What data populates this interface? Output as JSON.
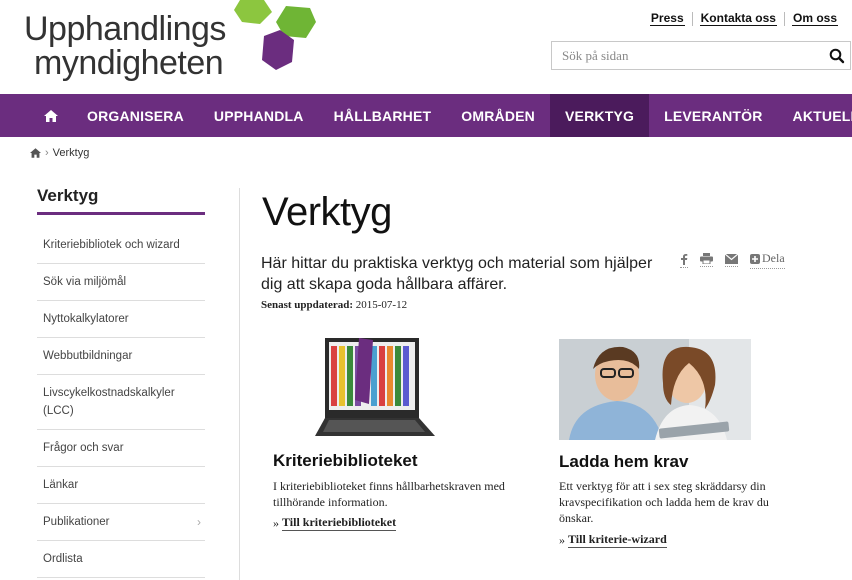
{
  "logo": {
    "line1": "Upphandlings",
    "line2": "myndigheten"
  },
  "toplinks": [
    "Press",
    "Kontakta oss",
    "Om oss"
  ],
  "search": {
    "placeholder": "Sök på sidan"
  },
  "nav": {
    "items": [
      "ORGANISERA",
      "UPPHANDLA",
      "HÅLLBARHET",
      "OMRÅDEN",
      "VERKTYG",
      "LEVERANTÖR",
      "AKTUELLT"
    ],
    "active": "VERKTYG"
  },
  "breadcrumb": {
    "current": "Verktyg"
  },
  "sidebar": {
    "title": "Verktyg",
    "items": [
      {
        "label": "Kriteriebibliotek och wizard"
      },
      {
        "label": "Sök via miljömål"
      },
      {
        "label": "Nyttokalkylatorer"
      },
      {
        "label": "Webbutbildningar"
      },
      {
        "label": "Livscykelkostnadskalkyler (LCC)"
      },
      {
        "label": "Frågor och svar"
      },
      {
        "label": "Länkar"
      },
      {
        "label": "Publikationer"
      },
      {
        "label": "Ordlista"
      }
    ]
  },
  "main": {
    "title": "Verktyg",
    "lead": "Här hittar du praktiska verktyg och material som hjälper dig att skapa goda hållbara affärer.",
    "updated_label": "Senast uppdaterad:",
    "updated_date": "2015-07-12",
    "share_label": "Dela"
  },
  "cards": [
    {
      "title": "Kriteriebiblioteket",
      "text": "I kriteriebiblioteket finns hållbarhetskraven med tillhörande information.",
      "link": "Till kriteriebiblioteket"
    },
    {
      "title": "Ladda hem krav",
      "text": "Ett verktyg för att i sex steg skräddarsy din kravspecifikation och ladda hem de krav du önskar.",
      "link": "Till kriterie-wizard"
    }
  ],
  "colors": {
    "brand_purple": "#6b2d7f",
    "active_purple": "#4b1b5c",
    "logo_green": "#6fb535",
    "logo_purple": "#6b2d7f"
  }
}
